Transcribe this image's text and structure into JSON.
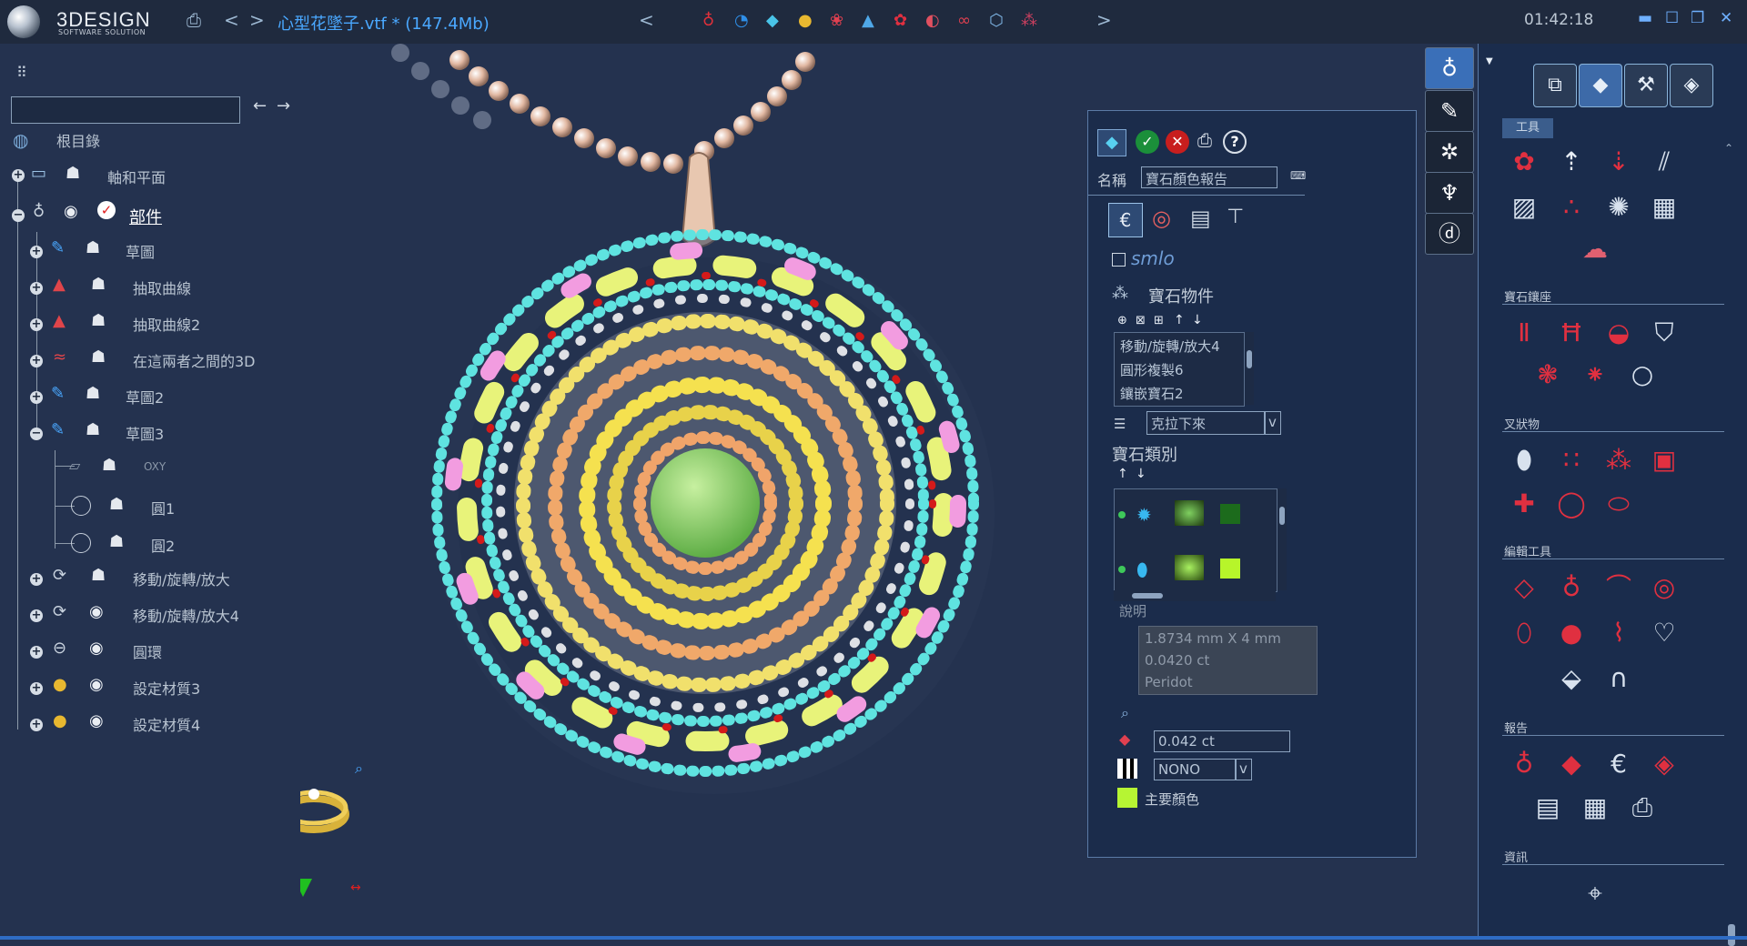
{
  "app": {
    "logo_text": "3DESIGN",
    "logo_subtitle": "SOFTWARE SOLUTION",
    "file_title": "心型花墜子.vtf * (147.4Mb)",
    "clock": "01:42:18"
  },
  "toolbar": {
    "back_label": "<",
    "forward_label": ">",
    "scroll_left_label": "<",
    "scroll_right_label": ">"
  },
  "window_controls": {
    "minimize": "▬",
    "maximize": "☐",
    "restore": "❐",
    "close": "✕"
  },
  "tree": {
    "search_value": "",
    "nav_back": "←",
    "nav_forward": "→",
    "root": "根目錄",
    "items": [
      {
        "label": "軸和平面"
      },
      {
        "label": "部件"
      },
      {
        "label": "草圖"
      },
      {
        "label": "抽取曲線"
      },
      {
        "label": "抽取曲線2"
      },
      {
        "label": "在這兩者之間的3D"
      },
      {
        "label": "草圖2"
      },
      {
        "label": "草圖3"
      },
      {
        "label": "OXY"
      },
      {
        "label": "圓1"
      },
      {
        "label": "圓2"
      },
      {
        "label": "移動/旋轉/放大"
      },
      {
        "label": "移動/旋轉/放大4"
      },
      {
        "label": "圓環"
      },
      {
        "label": "設定材質3"
      },
      {
        "label": "設定材質4"
      }
    ]
  },
  "dialog": {
    "name_label": "名稱",
    "name_value": "寶石顏色報告",
    "logo_text": "smlo",
    "gem_objects_label": "寶石物件",
    "gem_list": [
      "移動/旋轉/放大4",
      "圓形複製6",
      "鑲嵌寶石2"
    ],
    "dropdown_value": "克拉下來",
    "dropdown_arrow": "v",
    "gem_category_label": "寶石類別",
    "gem_category_colors": [
      "#1c6b1c",
      "#b7f52a"
    ],
    "description_label": "說明",
    "description_lines": [
      "1.8734 mm X 4 mm",
      "0.0420 ct",
      "Peridot"
    ],
    "carat_value": "0.042 ct",
    "nono_value": "NONO",
    "nono_arrow": "v",
    "main_color_label": "主要顏色",
    "main_color": "#b6f533"
  },
  "right_panel": {
    "tools_tab": "工具",
    "sections": [
      "寶石鑲座",
      "叉狀物",
      "編輯工具",
      "報告",
      "資訊"
    ]
  },
  "colors": {
    "accent": "#4aa8ff",
    "viewport_bg": "#24324f",
    "panel_bg": "#1a2c4c",
    "confirm": "#1b8f3a",
    "cancel": "#c81e1e"
  }
}
